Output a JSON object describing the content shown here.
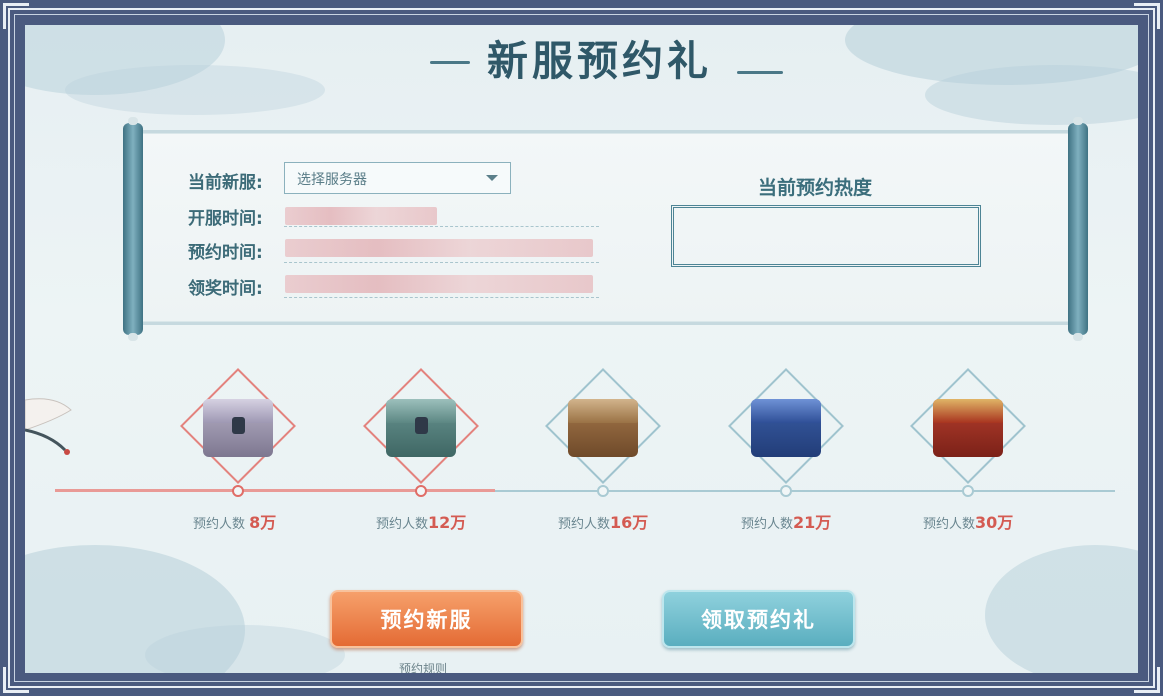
{
  "title": "新服预约礼",
  "form": {
    "server_label": "当前新服:",
    "server_select_placeholder": "选择服务器",
    "open_time_label": "开服时间:",
    "reserve_time_label": "预约时间:",
    "claim_time_label": "领奖时间:"
  },
  "heat": {
    "title": "当前预约热度"
  },
  "milestones": [
    {
      "prefix": "预约人数",
      "count": "8万"
    },
    {
      "prefix": "预约人数",
      "count": "12万"
    },
    {
      "prefix": "预约人数",
      "count": "16万"
    },
    {
      "prefix": "预约人数",
      "count": "21万"
    },
    {
      "prefix": "预约人数",
      "count": "30万"
    }
  ],
  "progress": {
    "reached_milestones": 2,
    "total_milestones": 5
  },
  "buttons": {
    "reserve": "预约新服",
    "claim": "领取预约礼"
  },
  "rules_link": "预约规则",
  "colors": {
    "frame": "#4a5a7f",
    "accent_orange": "#e46b34",
    "accent_teal": "#5aaebf",
    "highlight_red": "#d45b52",
    "text_teal": "#3c6b78"
  }
}
